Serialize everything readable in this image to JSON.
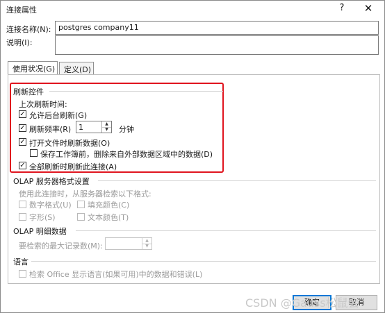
{
  "window": {
    "title": "连接属性",
    "help_glyph": "?",
    "close_glyph": "✕"
  },
  "connection": {
    "name_label": "连接名称(N):",
    "name_value": "postgres company11",
    "desc_label": "说明(I):",
    "desc_value": ""
  },
  "tabs": [
    {
      "label": "使用状况(G)",
      "active": true
    },
    {
      "label": "定义(D)",
      "active": false
    }
  ],
  "refresh": {
    "section_title": "刷新控件",
    "last_refresh_label": "上次刷新时间:",
    "background_refresh": {
      "label": "允许后台刷新(G)",
      "checked": true
    },
    "refresh_every": {
      "label": "刷新频率(R)",
      "checked": true,
      "value": "1",
      "unit": "分钟"
    },
    "refresh_on_open": {
      "label": "打开文件时刷新数据(O)",
      "checked": true
    },
    "remove_external": {
      "label": "保存工作簿前，删除来自外部数据区域中的数据(D)",
      "checked": false
    },
    "refresh_all": {
      "label": "全部刷新时刷新此连接(A)",
      "checked": true
    }
  },
  "olap_format": {
    "section_title": "OLAP 服务器格式设置",
    "hint": "使用此连接时，从服务器检索以下格式:",
    "number_format": "数字格式(U)",
    "fill_color": "填充颜色(C)",
    "font_style": "字形(S)",
    "text_color": "文本颜色(T)"
  },
  "olap_drill": {
    "section_title": "OLAP 明细数据",
    "max_records_label": "要检索的最大记录数(M):",
    "max_records_value": ""
  },
  "language": {
    "section_title": "语言",
    "office_language": "检索 Office 显示语言(如果可用)中的数据和错误(L)"
  },
  "buttons": {
    "ok": "确定",
    "cancel": "取消"
  },
  "watermark": "CSDN @Gauss松鼠会",
  "colors": {
    "highlight_box": "#e0141e",
    "ok_border": "#0078d7"
  }
}
